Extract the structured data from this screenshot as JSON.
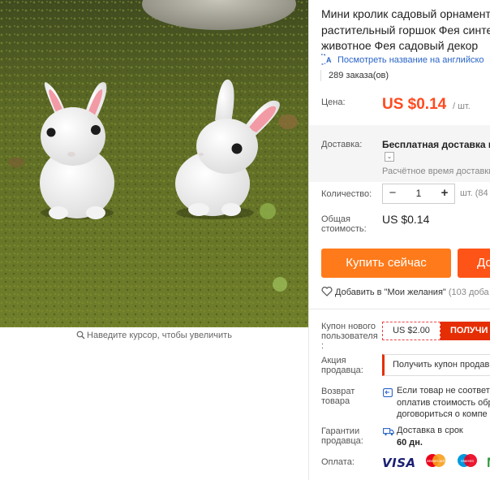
{
  "product": {
    "title_lines": [
      "Мини кролик садовый орнамент",
      "растительный горшок Фея синте",
      "животное Фея садовый декор"
    ],
    "translate_link": "Посмотреть название на английско",
    "orders": "289 заказа(ов)",
    "zoom_hint": "Наведите курсор, чтобы увеличить"
  },
  "price": {
    "label": "Цена:",
    "value": "US $0.14",
    "unit": "/ шт."
  },
  "shipping": {
    "label": "Доставка:",
    "value": "Бесплатная доставка в R",
    "toggle": "⌄",
    "estimate": "Расчётное время доставки"
  },
  "quantity": {
    "label": "Количество:",
    "minus": "−",
    "value": "1",
    "plus": "+",
    "unit": "шт. (84"
  },
  "total": {
    "label_lines": [
      "Общая",
      "стоимость:"
    ],
    "value": "US $0.14"
  },
  "actions": {
    "buy_now": "Купить сейчас",
    "add_to_cart": "До",
    "wishlist": "Добавить в \"Мои желания\"",
    "wishlist_count": "(103 доба"
  },
  "coupon": {
    "label_lines": [
      "Купон нового",
      "пользователя",
      ":"
    ],
    "amount": "US $2.00",
    "get": "ПОЛУЧИ"
  },
  "promo": {
    "label_lines": [
      "Акция",
      "продавца:"
    ],
    "button": "Получить купон продав"
  },
  "returns": {
    "label_lines": [
      "Возврат",
      "товара"
    ],
    "text_lines": [
      "Если товар не соответс",
      "оплатив стоимость обр",
      "договориться о компе"
    ]
  },
  "delivery_guarantee": {
    "label_lines": [
      "Гарантии",
      "продавца:"
    ],
    "text": "Доставка в срок",
    "days": "60 дн."
  },
  "payment": {
    "label": "Оплата:",
    "methods": [
      "VISA",
      "MasterCard",
      "Maestro",
      "M"
    ]
  },
  "colors": {
    "price": "#ff4a1f",
    "buy_button": "#ff7a1a",
    "cart_button": "#ff5417",
    "coupon_red": "#e62e04",
    "link": "#2a64c7"
  },
  "icons": [
    "search-icon",
    "translate-icon",
    "heart-icon",
    "chevron-down-icon",
    "return-icon",
    "delivery-icon"
  ]
}
